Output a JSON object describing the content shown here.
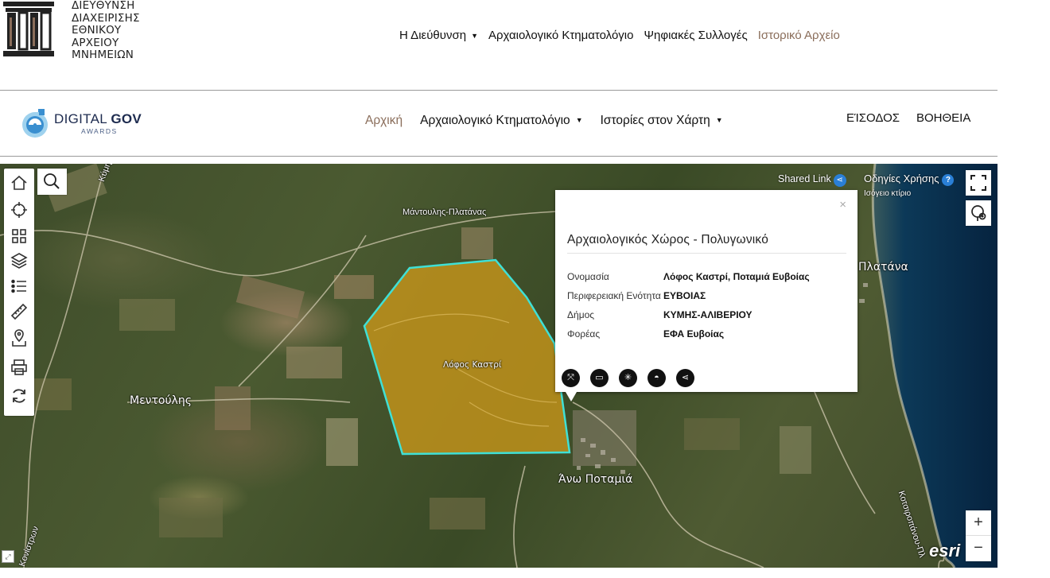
{
  "header": {
    "org_lines": [
      "ΔΙΕΥΘΥΝΣΗ",
      "ΔΙΑΧΕΙΡΙΣΗΣ",
      "ΕΘΝΙΚΟΥ",
      "ΑΡΧΕΙΟΥ",
      "ΜΝΗΜΕΙΩΝ"
    ],
    "nav": {
      "directorate": "Η Διεύθυνση",
      "cadastre": "Αρχαιολογικό Κτηματολόγιο",
      "collections": "Ψηφιακές Συλλογές",
      "archive": "Ιστορικό Αρχείο"
    }
  },
  "subheader": {
    "award_title_light": "DIGITAL ",
    "award_title_bold": "GOV",
    "award_sub": "AWARDS",
    "nav": {
      "home": "Αρχική",
      "cadastre": "Αρχαιολογικό Κτηματολόγιο",
      "stories": "Ιστορίες στον Χάρτη"
    },
    "login": "ΕΊΣΟΔΟΣ",
    "help": "ΒΟΗΘΕΙΑ"
  },
  "map": {
    "shared_link": "Shared Link",
    "instructions": "Οδηγίες Χρήσης",
    "instructions_icon": "?",
    "ground_floor": "Ισόγειο κτίριο",
    "places": {
      "mentoulis": "Μεντούλης",
      "ano_potamia": "Άνω Ποταμιά",
      "platana": "Πλατάνα",
      "site_label": "Λόφος Καστρί"
    },
    "roads": {
      "mantoulis_platanas": "Μάντουλης-Πλατάνας",
      "kymis": "Κύμης-",
      "konistron": "Κονίστρων",
      "kotsiropanou": "Κοτσιροπάνου-Πλ"
    },
    "zoom_in": "+",
    "zoom_out": "−",
    "attribution": "esri",
    "site_fill": "#c8961a",
    "site_outline": "#3fe0d6"
  },
  "popup": {
    "close": "×",
    "title": "Αρχαιολογικός Χώρος - Πολυγωνικό",
    "rows": [
      {
        "k": "Ονομασία",
        "v": "Λόφος Καστρί, Ποταμιά Ευβοίας"
      },
      {
        "k": "Περιφερειακή Ενότητα",
        "v": "ΕΥΒΟΙΑΣ"
      },
      {
        "k": "Δήμος",
        "v": "ΚΥΜΗΣ-ΑΛΙΒΕΡΙΟΥ"
      },
      {
        "k": "Φορέας",
        "v": "ΕΦΑ Ευβοίας"
      }
    ]
  },
  "colors": {
    "accent_brown": "#8a6d5a",
    "popup_action": "#111111",
    "link_blue": "#2a7fd6"
  }
}
